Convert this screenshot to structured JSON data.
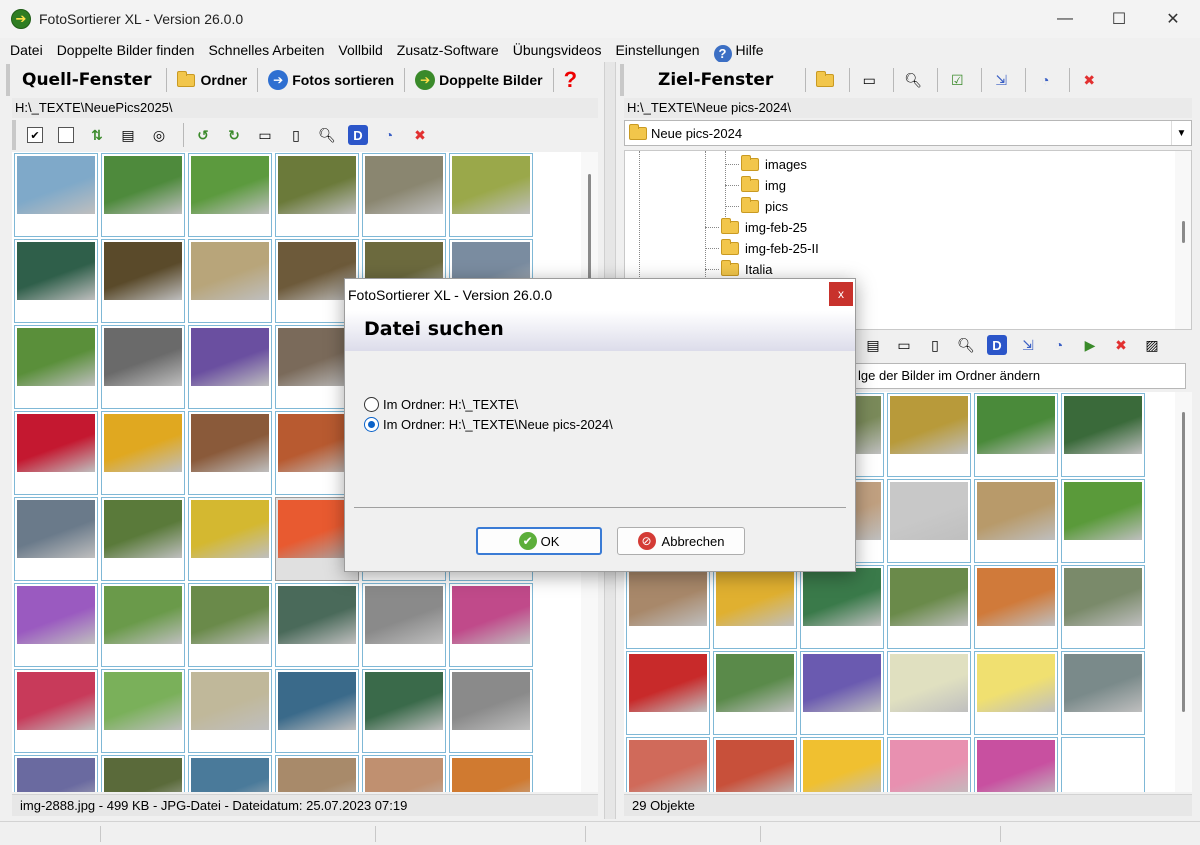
{
  "window": {
    "title": "FotoSortierer XL - Version 26.0.0"
  },
  "menu": {
    "items": [
      "Datei",
      "Doppelte Bilder finden",
      "Schnelles Arbeiten",
      "Vollbild",
      "Zusatz-Software",
      "Übungsvideos",
      "Einstellungen"
    ],
    "help": "Hilfe"
  },
  "left": {
    "title": "Quell-Fenster",
    "folder_btn": "Ordner",
    "sort_btn": "Fotos sortieren",
    "dup_btn": "Doppelte Bilder",
    "path": "H:\\_TEXTE\\NeuePics2025\\",
    "status": "img-2888.jpg - 499 KB - JPG-Datei - Dateidatum: 25.07.2023 07:19"
  },
  "right": {
    "title": "Ziel-Fenster",
    "path": "H:\\_TEXTE\\Neue pics-2024\\",
    "combo": "Neue pics-2024",
    "tree": [
      "images",
      "img",
      "pics",
      "img-feb-25",
      "img-feb-25-II",
      "Italia"
    ],
    "sort_text": "lge der Bilder im Ordner ändern",
    "status": "29 Objekte"
  },
  "dialog": {
    "title": "FotoSortierer XL - Version 26.0.0",
    "close": "x",
    "header": "Datei suchen",
    "option1": "Im Ordner: H:\\_TEXTE\\",
    "option2": "Im Ordner: H:\\_TEXTE\\Neue pics-2024\\",
    "ok": "OK",
    "cancel": "Abbrechen"
  },
  "thumb_colors_left": [
    [
      "#7fa9c9",
      "#4e8a3c",
      "#5c9a3e",
      "#6b7a3a",
      "#8a8670",
      "#9aa84a"
    ],
    [
      "#2f5f4a",
      "#5a4a2a",
      "#b8a57a",
      "#6d5a3a",
      "#6c6a3e",
      "#7a8ca0"
    ],
    [
      "#5a8f3a",
      "#6a6a6a",
      "#6a4fa0",
      "#7a6a5a",
      "#9a8a7a",
      "#7e8c6a"
    ],
    [
      "#c41830",
      "#e0a820",
      "#8a5a3a",
      "#b85a30",
      "#9a9a9a",
      "#7a7a7a"
    ],
    [
      "#6a7a8a",
      "#5a7a3a",
      "#d4b830",
      "#e85a30",
      "#9a9a9a",
      "#6a8aa0"
    ],
    [
      "#9a5ac0",
      "#6a9a4a",
      "#6a8a4a",
      "#4a6a5a",
      "#8a8a8a",
      "#c04a8a"
    ],
    [
      "#c83a5a",
      "#7ab05a",
      "#c0b89a",
      "#3a6a8a",
      "#3a6a4a",
      "#8a8a8a"
    ],
    [
      "#6a6aa0",
      "#5a6a3a",
      "#4a7a9a",
      "#a88a6a",
      "#c09070",
      "#d07a30"
    ]
  ],
  "thumb_colors_right": [
    [
      "#5a8a9a",
      "#5a7a4a",
      "#7a8a5a",
      "#b89a3a",
      "#4a8a3a",
      "#3a6a3a"
    ],
    [
      "#7a6a5a",
      "#8a9a6a",
      "#c0a080",
      "#c8c8c8",
      "#b89a6a",
      "#5a9a3a"
    ],
    [
      "#a8886a",
      "#e0b030",
      "#3a7a4a",
      "#6a8a4a",
      "#d07a3a",
      "#7a8a6a"
    ],
    [
      "#c82a2a",
      "#5a8a4a",
      "#6a5ab0",
      "#e0e0c0",
      "#f0e070",
      "#7a8a8a"
    ],
    [
      "#d06a5a",
      "#c8503a",
      "#f0c030",
      "#e890b0",
      "#c850a0",
      "#ffffff"
    ]
  ]
}
